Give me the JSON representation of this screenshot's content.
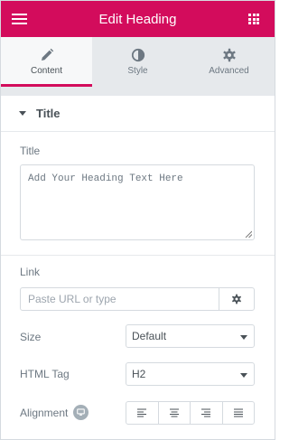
{
  "header": {
    "title": "Edit Heading",
    "menu_icon": "hamburger-icon",
    "widgets_icon": "grid-icon",
    "color": "#d30c5c"
  },
  "tabs": [
    {
      "label": "Content",
      "icon": "pencil-icon",
      "active": true
    },
    {
      "label": "Style",
      "icon": "half-circle-icon",
      "active": false
    },
    {
      "label": "Advanced",
      "icon": "gear-icon",
      "active": false
    }
  ],
  "section": {
    "title": "Title",
    "expanded": true
  },
  "fields": {
    "title_label": "Title",
    "title_placeholder": "Add Your Heading Text Here",
    "link_label": "Link",
    "link_placeholder": "Paste URL or type",
    "size_label": "Size",
    "size_value": "Default",
    "html_tag_label": "HTML Tag",
    "html_tag_value": "H2",
    "alignment_label": "Alignment"
  },
  "alignment_options": [
    "align-left",
    "align-center",
    "align-right",
    "align-justify"
  ]
}
